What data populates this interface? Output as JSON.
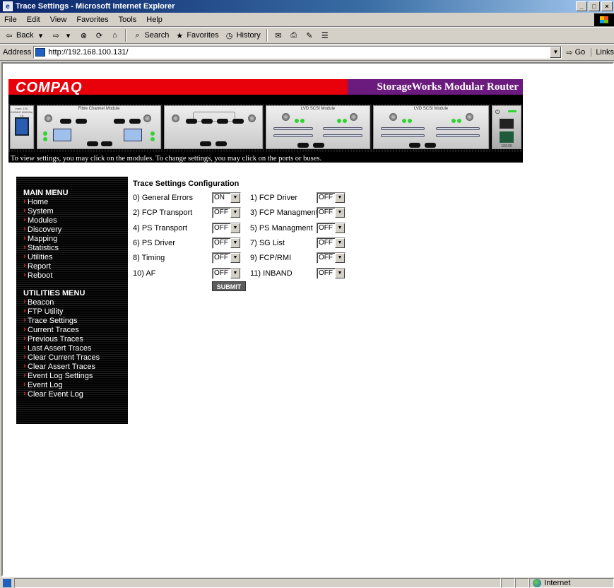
{
  "window": {
    "title": "Trace Settings - Microsoft Internet Explorer"
  },
  "menubar": {
    "items": [
      "File",
      "Edit",
      "View",
      "Favorites",
      "Tools",
      "Help"
    ]
  },
  "toolbar": {
    "back": "Back",
    "search": "Search",
    "favorites": "Favorites",
    "history": "History"
  },
  "addressbar": {
    "label": "Address",
    "url": "http://192.168.100.131/",
    "go": "Go",
    "links": "Links"
  },
  "banner": {
    "logo": "COMPAQ",
    "product": "StorageWorks Modular Router",
    "modules": {
      "fc": "Fibre Channel Module",
      "lvd1": "LVD SCSI Module",
      "lvd2": "LVD SCSI Module",
      "power_label": "Input: 100-240VAC 50/60Hz, 1A",
      "eth_label": "10/100"
    },
    "caption": "To view settings, you may click on the modules. To change settings, you may click on the ports or buses."
  },
  "main_menu": {
    "heading": "MAIN MENU",
    "items": [
      "Home",
      "System",
      "Modules",
      "Discovery",
      "Mapping",
      "Statistics",
      "Utilities",
      "Report",
      "Reboot"
    ]
  },
  "utilities_menu": {
    "heading": "UTILITIES MENU",
    "items": [
      "Beacon",
      "FTP Utility",
      "Trace Settings",
      "Current Traces",
      "Previous Traces",
      "Last Assert Traces",
      "Clear Current Traces",
      "Clear Assert Traces",
      "Event Log Settings",
      "Event Log",
      "Clear Event Log"
    ]
  },
  "trace_form": {
    "title": "Trace Settings Configuration",
    "fields": [
      {
        "label": "0) General Errors",
        "value": "ON"
      },
      {
        "label": "1) FCP Driver",
        "value": "OFF"
      },
      {
        "label": "2) FCP Transport",
        "value": "OFF"
      },
      {
        "label": "3) FCP Managment",
        "value": "OFF"
      },
      {
        "label": "4) PS Transport",
        "value": "OFF"
      },
      {
        "label": "5) PS Managment",
        "value": "OFF"
      },
      {
        "label": "6) PS Driver",
        "value": "OFF"
      },
      {
        "label": "7) SG List",
        "value": "OFF"
      },
      {
        "label": "8) Timing",
        "value": "OFF"
      },
      {
        "label": "9) FCP/RMI",
        "value": "OFF"
      },
      {
        "label": "10) AF",
        "value": "OFF"
      },
      {
        "label": "11) INBAND",
        "value": "OFF"
      }
    ],
    "submit": "SUBMIT"
  },
  "statusbar": {
    "zone": "Internet"
  }
}
